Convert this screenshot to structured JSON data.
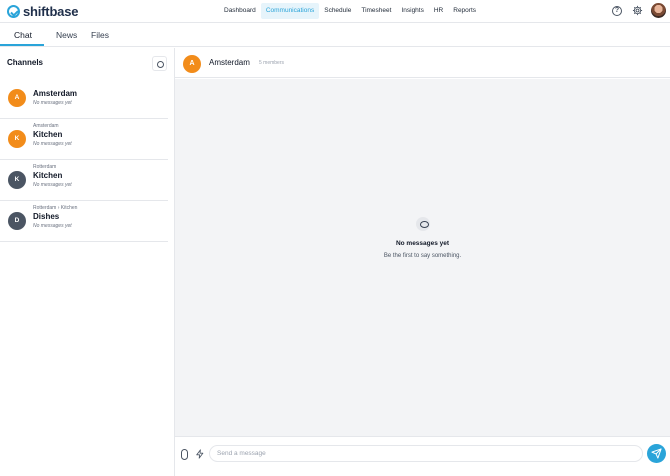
{
  "app": {
    "brand": "shiftbase"
  },
  "nav": {
    "items": [
      {
        "label": "Dashboard",
        "active": false
      },
      {
        "label": "Communications",
        "active": true
      },
      {
        "label": "Schedule",
        "active": false
      },
      {
        "label": "Timesheet",
        "active": false
      },
      {
        "label": "Insights",
        "active": false
      },
      {
        "label": "HR",
        "active": false
      },
      {
        "label": "Reports",
        "active": false
      }
    ],
    "icons": [
      "help-icon",
      "gear-icon",
      "user-avatar"
    ]
  },
  "tabs": [
    {
      "label": "Chat",
      "active": true
    },
    {
      "label": "News",
      "active": false
    },
    {
      "label": "Files",
      "active": false
    }
  ],
  "sidebar": {
    "title": "Channels",
    "channels": [
      {
        "initial": "A",
        "context": "",
        "name": "Amsterdam",
        "status": "No messages yet",
        "color": "#f28c1a"
      },
      {
        "initial": "K",
        "context": "Amsterdam",
        "name": "Kitchen",
        "status": "No messages yet",
        "color": "#f28c1a"
      },
      {
        "initial": "K",
        "context": "Rotterdam",
        "name": "Kitchen",
        "status": "No messages yet",
        "color": "#4b5563"
      },
      {
        "initial": "D",
        "context": "Rotterdam › Kitchen",
        "name": "Dishes",
        "status": "No messages yet",
        "color": "#4b5563"
      }
    ]
  },
  "channel": {
    "initial": "A",
    "name": "Amsterdam",
    "members": "5 members",
    "color": "#f28c1a"
  },
  "empty_state": {
    "title": "No messages yet",
    "subtitle": "Be the first to say something."
  },
  "composer": {
    "placeholder": "Send a message",
    "value": ""
  },
  "colors": {
    "accent": "#2aa4d9",
    "orange": "#f28c1a",
    "gray_avatar": "#4b5563"
  }
}
